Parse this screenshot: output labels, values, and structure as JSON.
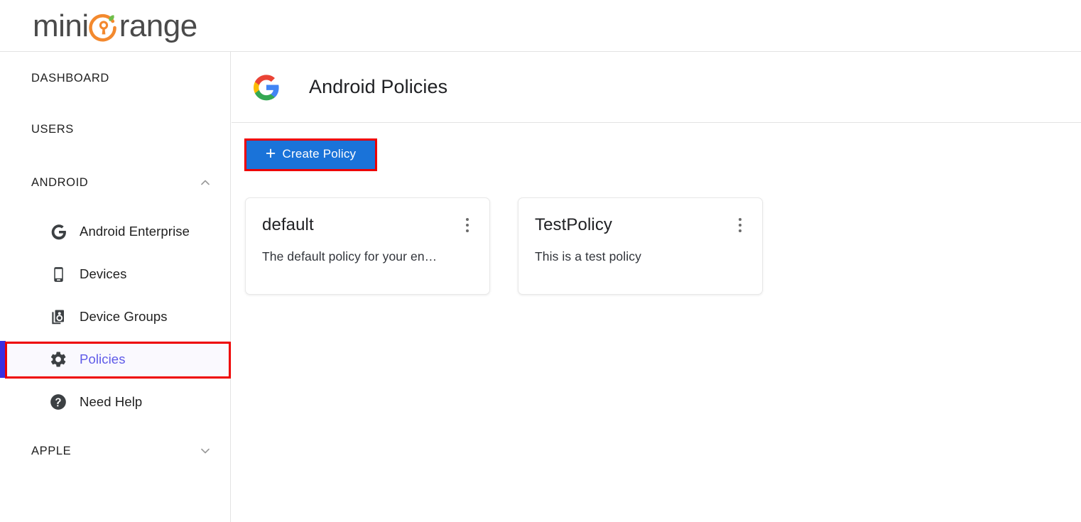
{
  "brand": {
    "name_part1": "mini",
    "name_part2": "range",
    "logo_icon": "miniorange-keyhole-logo",
    "colors": {
      "text": "#4a4a4a",
      "orange": "#f3892e",
      "leaf": "#6fbe4a"
    }
  },
  "sidebar": {
    "top_items": [
      {
        "label": "DASHBOARD",
        "name": "sidebar-item-dashboard"
      },
      {
        "label": "USERS",
        "name": "sidebar-item-users"
      }
    ],
    "groups": [
      {
        "label": "ANDROID",
        "name": "sidebar-group-android",
        "expanded": true,
        "chevron_icon": "chevron-up-icon",
        "items": [
          {
            "label": "Android Enterprise",
            "icon": "google-g-icon",
            "active": false
          },
          {
            "label": "Devices",
            "icon": "smartphone-icon",
            "active": false
          },
          {
            "label": "Device Groups",
            "icon": "device-groups-icon",
            "active": false
          },
          {
            "label": "Policies",
            "icon": "gear-icon",
            "active": true
          },
          {
            "label": "Need Help",
            "icon": "help-circle-icon",
            "active": false
          }
        ]
      },
      {
        "label": "APPLE",
        "name": "sidebar-group-apple",
        "expanded": false,
        "chevron_icon": "chevron-down-icon",
        "items": []
      }
    ],
    "active_item_label": "Policies",
    "active_color": "#5f5ae8",
    "active_accent_color": "#3b2fe0",
    "active_bg": "#faf9fe"
  },
  "page": {
    "title": "Android Policies",
    "title_icon": "google-multicolor-g-icon"
  },
  "toolbar": {
    "create_label": "Create Policy",
    "create_plus_icon": "plus-icon",
    "create_bg": "#1a73d9"
  },
  "policies": [
    {
      "name": "default",
      "description": "The default policy for your en…",
      "menu_icon": "kebab-menu-icon"
    },
    {
      "name": "TestPolicy",
      "description": "This is a test policy",
      "menu_icon": "kebab-menu-icon"
    }
  ],
  "annotations": {
    "highlight_color": "#ee0000",
    "targets": [
      "create-policy-button",
      "sidebar-item-policies"
    ]
  }
}
